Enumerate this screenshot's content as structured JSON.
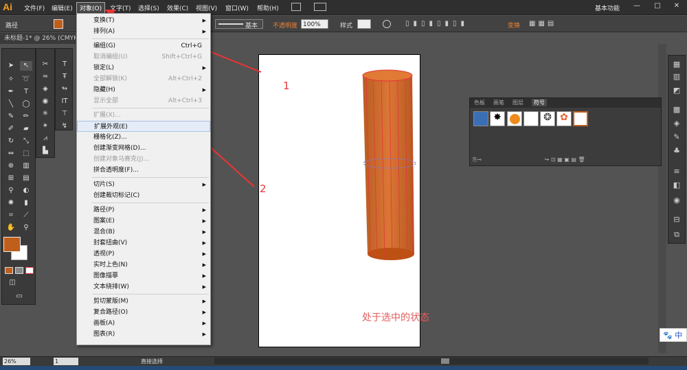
{
  "app": {
    "logo": "Ai"
  },
  "menubar": {
    "items": [
      "文件(F)",
      "编辑(E)",
      "对象(O)",
      "文字(T)",
      "选择(S)",
      "效果(C)",
      "视图(V)",
      "窗口(W)",
      "帮助(H)"
    ],
    "workspace": "基本功能",
    "window_buttons": [
      "—",
      "□",
      "✕"
    ]
  },
  "controlbar": {
    "path_label": "路径",
    "fill_color": "#c05f1c",
    "stroke_profile": "基本",
    "opacity_label": "不透明度",
    "opacity_value": "100%",
    "style_label": "样式",
    "transform_label": "变换"
  },
  "document": {
    "tab_title": "未标题-1* @ 26% (CMYK"
  },
  "object_menu": [
    {
      "label": "变换(T)",
      "submenu": true
    },
    {
      "label": "排列(A)",
      "submenu": true
    },
    {
      "sep": true
    },
    {
      "label": "编组(G)",
      "shortcut": "Ctrl+G"
    },
    {
      "label": "取消编组(U)",
      "shortcut": "Shift+Ctrl+G",
      "disabled": true
    },
    {
      "label": "锁定(L)",
      "submenu": true
    },
    {
      "label": "全部解锁(K)",
      "shortcut": "Alt+Ctrl+2",
      "disabled": true
    },
    {
      "label": "隐藏(H)",
      "submenu": true
    },
    {
      "label": "显示全部",
      "shortcut": "Alt+Ctrl+3",
      "disabled": true
    },
    {
      "sep": true
    },
    {
      "label": "扩展(X)...",
      "disabled": true
    },
    {
      "label": "扩展外观(E)",
      "highlight": true
    },
    {
      "label": "栅格化(Z)..."
    },
    {
      "label": "创建渐变网格(D)..."
    },
    {
      "label": "创建对象马赛克(J)...",
      "disabled": true
    },
    {
      "label": "拼合透明度(F)..."
    },
    {
      "sep": true
    },
    {
      "label": "切片(S)",
      "submenu": true
    },
    {
      "label": "创建裁切标记(C)"
    },
    {
      "sep": true
    },
    {
      "label": "路径(P)",
      "submenu": true
    },
    {
      "label": "图案(E)",
      "submenu": true
    },
    {
      "label": "混合(B)",
      "submenu": true
    },
    {
      "label": "封套扭曲(V)",
      "submenu": true
    },
    {
      "label": "透视(P)",
      "submenu": true
    },
    {
      "label": "实时上色(N)",
      "submenu": true
    },
    {
      "label": "图像描摹",
      "submenu": true
    },
    {
      "label": "文本绕排(W)",
      "submenu": true
    },
    {
      "sep": true
    },
    {
      "label": "剪切蒙版(M)",
      "submenu": true
    },
    {
      "label": "复合路径(O)",
      "submenu": true
    },
    {
      "label": "画板(A)",
      "submenu": true
    },
    {
      "label": "图表(R)",
      "submenu": true
    }
  ],
  "canvas": {
    "annotation_1": "1",
    "annotation_2": "2",
    "caption": "处于选中的状态",
    "cylinder_color": "#d2601a"
  },
  "symbols_panel": {
    "tabs": [
      "色板",
      "画笔",
      "图层",
      "符号"
    ],
    "active_tab": "符号"
  },
  "statusbar": {
    "zoom": "26%",
    "page": "1",
    "tool_status": "直接选择"
  },
  "ime": {
    "label": "中"
  }
}
